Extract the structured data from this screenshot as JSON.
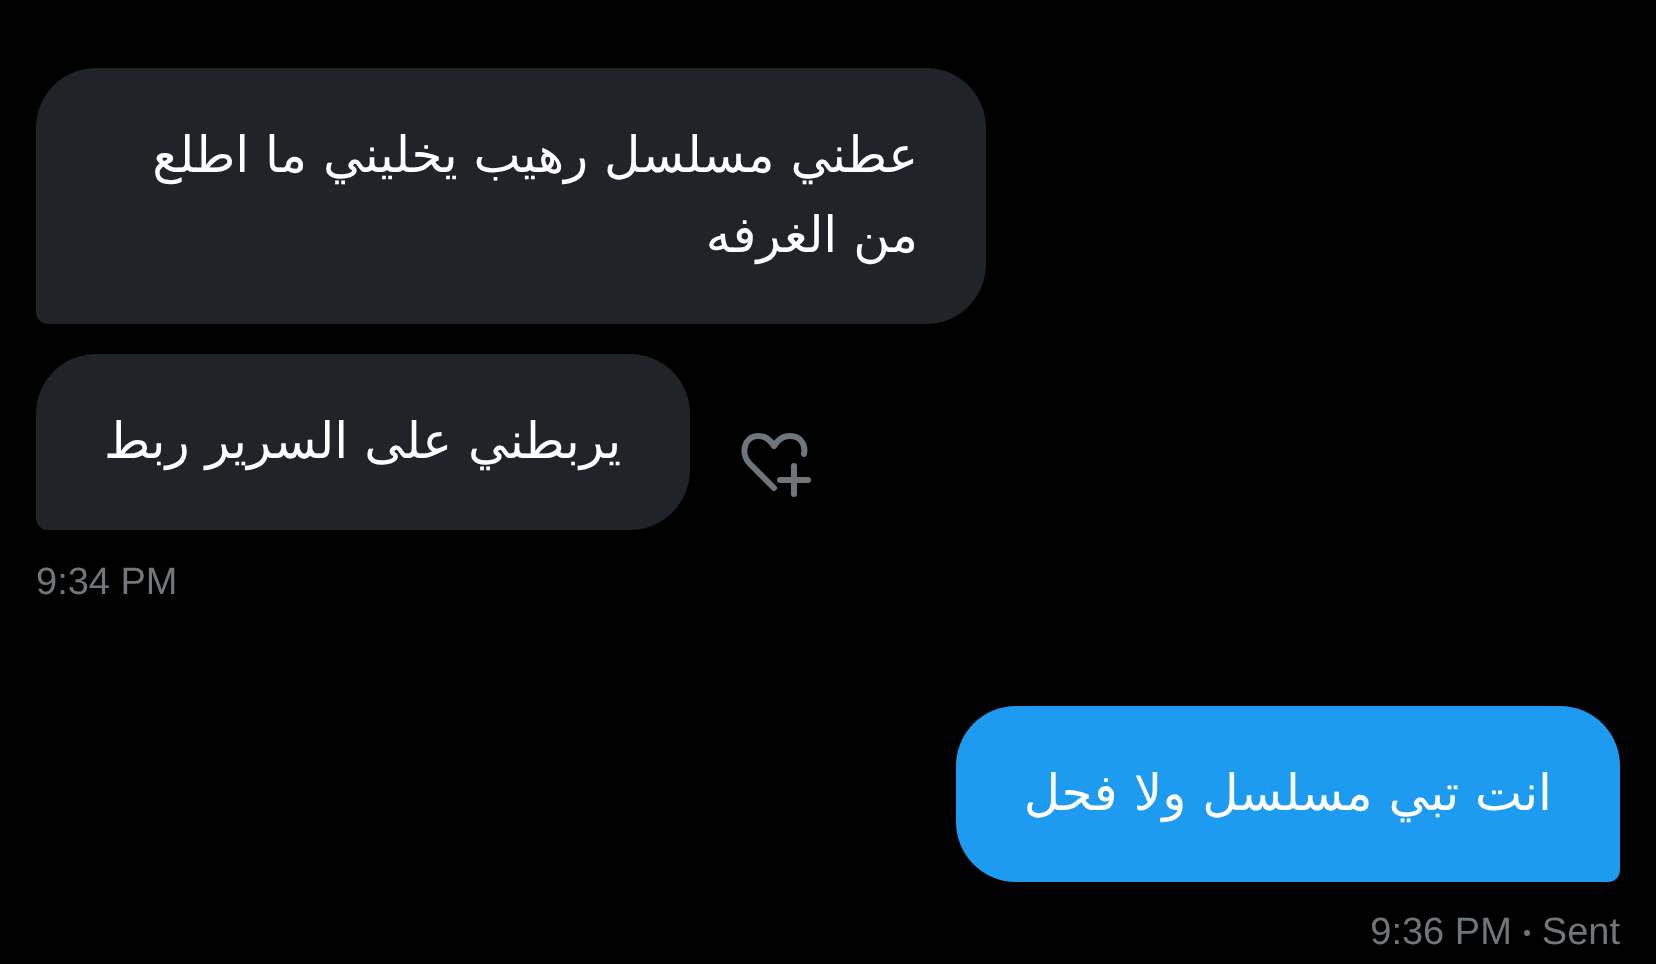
{
  "messages": [
    {
      "kind": "incoming",
      "text": "عطني مسلسل رهيب يخليني ما اطلع من الغرفه"
    },
    {
      "kind": "incoming",
      "text": "يربطني على السرير ربط",
      "react_button": true
    },
    {
      "kind": "incoming_time",
      "time": "9:34 PM"
    },
    {
      "kind": "outgoing",
      "text": "انت تبي مسلسل ولا فحل"
    },
    {
      "kind": "outgoing_time",
      "time": "9:36 PM",
      "status": "Sent"
    }
  ]
}
